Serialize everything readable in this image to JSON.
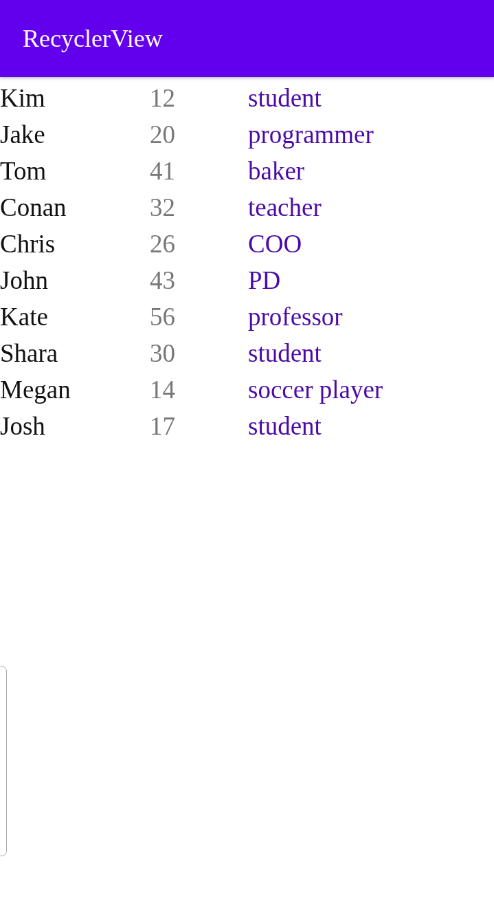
{
  "app_bar": {
    "title": "RecyclerView"
  },
  "rows": [
    {
      "name": "Kim",
      "age": "12",
      "job": "student"
    },
    {
      "name": "Jake",
      "age": "20",
      "job": "programmer"
    },
    {
      "name": "Tom",
      "age": "41",
      "job": "baker"
    },
    {
      "name": "Conan",
      "age": "32",
      "job": "teacher"
    },
    {
      "name": "Chris",
      "age": "26",
      "job": "COO"
    },
    {
      "name": "John",
      "age": "43",
      "job": "PD"
    },
    {
      "name": "Kate",
      "age": "56",
      "job": "professor"
    },
    {
      "name": "Shara",
      "age": "30",
      "job": "student"
    },
    {
      "name": "Megan",
      "age": "14",
      "job": "soccer player"
    },
    {
      "name": "Josh",
      "age": "17",
      "job": "student"
    }
  ]
}
